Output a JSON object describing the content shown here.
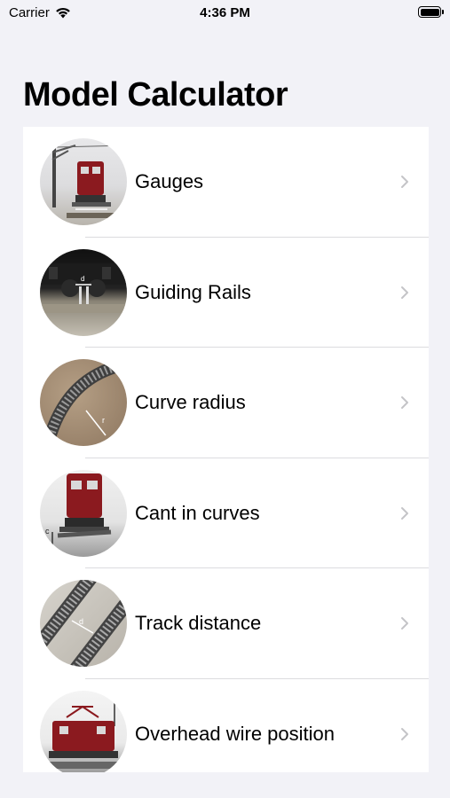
{
  "status_bar": {
    "carrier": "Carrier",
    "time": "4:36 PM"
  },
  "page": {
    "title": "Model Calculator"
  },
  "items": [
    {
      "label": "Gauges",
      "icon": "locomotive-gauge-photo"
    },
    {
      "label": "Guiding Rails",
      "icon": "wheel-guide-photo"
    },
    {
      "label": "Curve radius",
      "icon": "curved-track-photo"
    },
    {
      "label": "Cant in curves",
      "icon": "cant-locomotive-photo"
    },
    {
      "label": "Track distance",
      "icon": "parallel-tracks-photo"
    },
    {
      "label": "Overhead wire position",
      "icon": "pantograph-locomotive-photo"
    }
  ],
  "colors": {
    "background": "#f2f2f7",
    "cell": "#ffffff",
    "chevron": "#c4c4c7",
    "loco_red": "#8b1a1f"
  }
}
